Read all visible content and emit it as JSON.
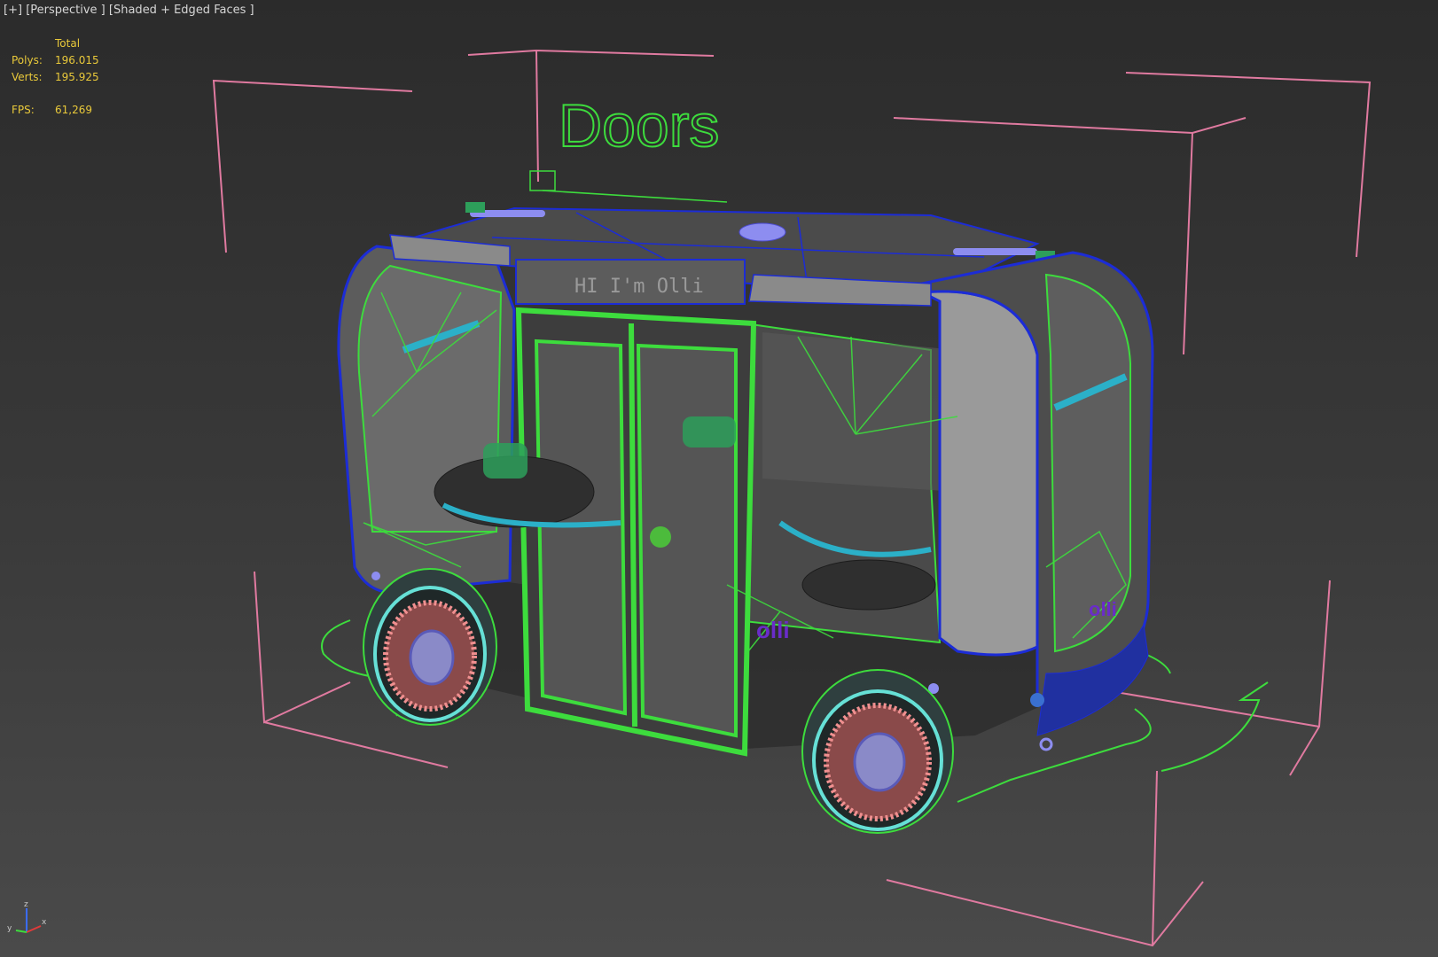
{
  "viewport": {
    "label_plus": "[+]",
    "label_view": "[Perspective ]",
    "label_shading": "[Shaded + Edged Faces ]"
  },
  "stats": {
    "header": "Total",
    "polys_label": "Polys:",
    "polys_value": "196.015",
    "verts_label": "Verts:",
    "verts_value": "195.925",
    "fps_label": "FPS:",
    "fps_value": "61,269"
  },
  "scene": {
    "helper_text": "Doors",
    "display_sign": "HI I'm Olli",
    "logo_text": "olli"
  },
  "axis_gizmo": {
    "x": "x",
    "y": "y",
    "z": "z"
  },
  "colors": {
    "wire_green": "#3ddc3d",
    "wire_blue": "#1c2cd6",
    "bbox_pink": "#e07aa0",
    "stats_yellow": "#e9c93a"
  }
}
